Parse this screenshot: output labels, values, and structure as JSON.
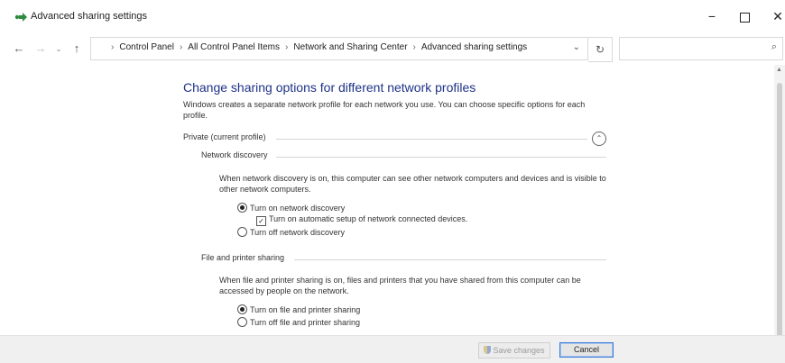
{
  "window": {
    "title": "Advanced sharing settings",
    "icon": "network-sharing-icon",
    "controls": {
      "minimize": "−",
      "close": "✕"
    }
  },
  "nav": {
    "back": "←",
    "forward": "→",
    "recent": "⌄",
    "up": "↑",
    "breadcrumbs": [
      "Control Panel",
      "All Control Panel Items",
      "Network and Sharing Center",
      "Advanced sharing settings"
    ],
    "breadcrumb_separator": "›",
    "dropdown": "⌄",
    "refresh": "↻",
    "search_placeholder": "",
    "search_icon": "⌕"
  },
  "content": {
    "heading": "Change sharing options for different network profiles",
    "intro": "Windows creates a separate network profile for each network you use. You can choose specific options for each profile.",
    "profile": {
      "label": "Private (current profile)",
      "collapse": "⌃"
    },
    "network_discovery": {
      "title": "Network discovery",
      "description": "When network discovery is on, this computer can see other network computers and devices and is visible to other network computers.",
      "option_on": "Turn on network discovery",
      "option_auto": "Turn on automatic setup of network connected devices.",
      "option_off": "Turn off network discovery",
      "selected": "on",
      "auto_checked": true
    },
    "file_printer": {
      "title": "File and printer sharing",
      "description": "When file and printer sharing is on, files and printers that you have shared from this computer can be accessed by people on the network.",
      "option_on": "Turn on file and printer sharing",
      "option_off": "Turn off file and printer sharing",
      "selected": "on"
    }
  },
  "footer": {
    "save_label": "Save changes",
    "cancel_label": "Cancel"
  },
  "colors": {
    "heading": "#1e3287",
    "focus_border": "#3d7bd5"
  }
}
